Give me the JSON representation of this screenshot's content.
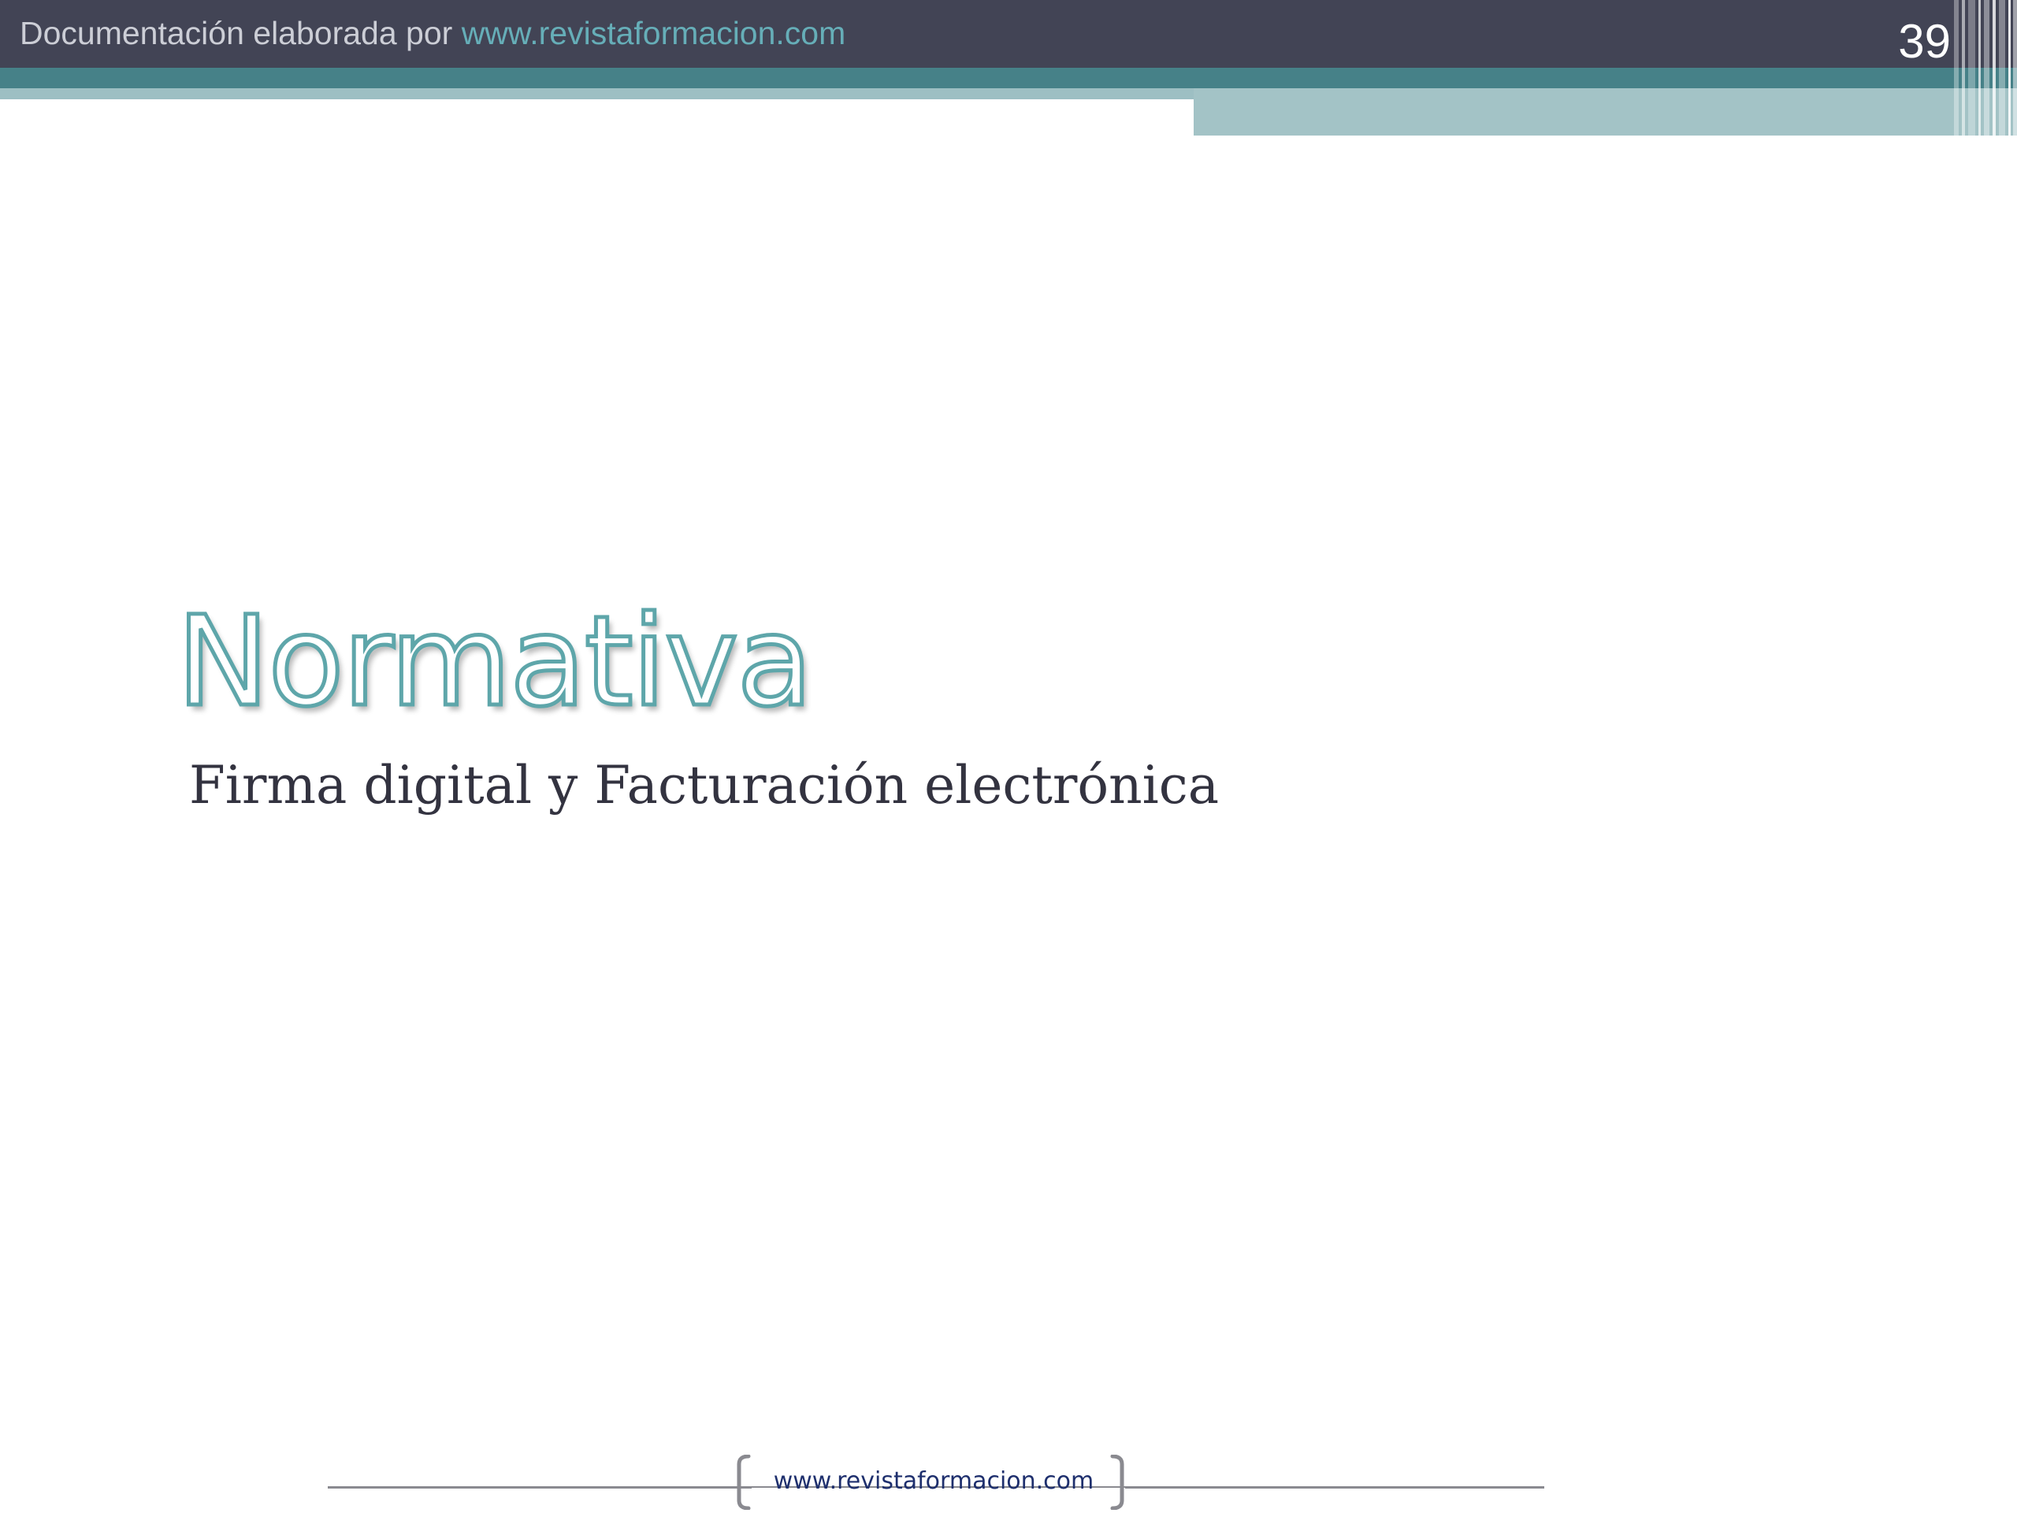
{
  "header": {
    "prefix_text": "Documentación elaborada por ",
    "link_text": "www.revistaformacion.com",
    "slide_number": "39"
  },
  "content": {
    "title": "Normativa",
    "subtitle": "Firma digital y Facturación electrónica"
  },
  "footer": {
    "url_text": "www.revistaformacion.com"
  },
  "colors": {
    "header_bg": "#424455",
    "header_text": "#ccced6",
    "header_link": "#66aeb8",
    "teal_band": "#468188",
    "light_teal_band": "#a3c3c6",
    "title_outline": "#5ea6aa",
    "subtitle_text": "#333340",
    "footer_text": "#1e2f6d"
  }
}
